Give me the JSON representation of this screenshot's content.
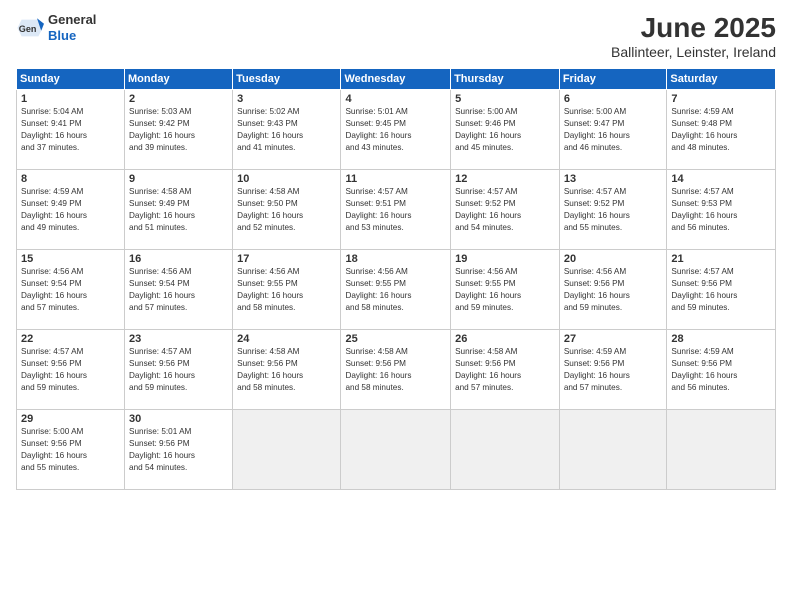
{
  "header": {
    "logo_general": "General",
    "logo_blue": "Blue",
    "month": "June 2025",
    "location": "Ballinteer, Leinster, Ireland"
  },
  "days_of_week": [
    "Sunday",
    "Monday",
    "Tuesday",
    "Wednesday",
    "Thursday",
    "Friday",
    "Saturday"
  ],
  "weeks": [
    [
      {
        "day": 1,
        "info": "Sunrise: 5:04 AM\nSunset: 9:41 PM\nDaylight: 16 hours\nand 37 minutes."
      },
      {
        "day": 2,
        "info": "Sunrise: 5:03 AM\nSunset: 9:42 PM\nDaylight: 16 hours\nand 39 minutes."
      },
      {
        "day": 3,
        "info": "Sunrise: 5:02 AM\nSunset: 9:43 PM\nDaylight: 16 hours\nand 41 minutes."
      },
      {
        "day": 4,
        "info": "Sunrise: 5:01 AM\nSunset: 9:45 PM\nDaylight: 16 hours\nand 43 minutes."
      },
      {
        "day": 5,
        "info": "Sunrise: 5:00 AM\nSunset: 9:46 PM\nDaylight: 16 hours\nand 45 minutes."
      },
      {
        "day": 6,
        "info": "Sunrise: 5:00 AM\nSunset: 9:47 PM\nDaylight: 16 hours\nand 46 minutes."
      },
      {
        "day": 7,
        "info": "Sunrise: 4:59 AM\nSunset: 9:48 PM\nDaylight: 16 hours\nand 48 minutes."
      }
    ],
    [
      {
        "day": 8,
        "info": "Sunrise: 4:59 AM\nSunset: 9:49 PM\nDaylight: 16 hours\nand 49 minutes."
      },
      {
        "day": 9,
        "info": "Sunrise: 4:58 AM\nSunset: 9:49 PM\nDaylight: 16 hours\nand 51 minutes."
      },
      {
        "day": 10,
        "info": "Sunrise: 4:58 AM\nSunset: 9:50 PM\nDaylight: 16 hours\nand 52 minutes."
      },
      {
        "day": 11,
        "info": "Sunrise: 4:57 AM\nSunset: 9:51 PM\nDaylight: 16 hours\nand 53 minutes."
      },
      {
        "day": 12,
        "info": "Sunrise: 4:57 AM\nSunset: 9:52 PM\nDaylight: 16 hours\nand 54 minutes."
      },
      {
        "day": 13,
        "info": "Sunrise: 4:57 AM\nSunset: 9:52 PM\nDaylight: 16 hours\nand 55 minutes."
      },
      {
        "day": 14,
        "info": "Sunrise: 4:57 AM\nSunset: 9:53 PM\nDaylight: 16 hours\nand 56 minutes."
      }
    ],
    [
      {
        "day": 15,
        "info": "Sunrise: 4:56 AM\nSunset: 9:54 PM\nDaylight: 16 hours\nand 57 minutes."
      },
      {
        "day": 16,
        "info": "Sunrise: 4:56 AM\nSunset: 9:54 PM\nDaylight: 16 hours\nand 57 minutes."
      },
      {
        "day": 17,
        "info": "Sunrise: 4:56 AM\nSunset: 9:55 PM\nDaylight: 16 hours\nand 58 minutes."
      },
      {
        "day": 18,
        "info": "Sunrise: 4:56 AM\nSunset: 9:55 PM\nDaylight: 16 hours\nand 58 minutes."
      },
      {
        "day": 19,
        "info": "Sunrise: 4:56 AM\nSunset: 9:55 PM\nDaylight: 16 hours\nand 59 minutes."
      },
      {
        "day": 20,
        "info": "Sunrise: 4:56 AM\nSunset: 9:56 PM\nDaylight: 16 hours\nand 59 minutes."
      },
      {
        "day": 21,
        "info": "Sunrise: 4:57 AM\nSunset: 9:56 PM\nDaylight: 16 hours\nand 59 minutes."
      }
    ],
    [
      {
        "day": 22,
        "info": "Sunrise: 4:57 AM\nSunset: 9:56 PM\nDaylight: 16 hours\nand 59 minutes."
      },
      {
        "day": 23,
        "info": "Sunrise: 4:57 AM\nSunset: 9:56 PM\nDaylight: 16 hours\nand 59 minutes."
      },
      {
        "day": 24,
        "info": "Sunrise: 4:58 AM\nSunset: 9:56 PM\nDaylight: 16 hours\nand 58 minutes."
      },
      {
        "day": 25,
        "info": "Sunrise: 4:58 AM\nSunset: 9:56 PM\nDaylight: 16 hours\nand 58 minutes."
      },
      {
        "day": 26,
        "info": "Sunrise: 4:58 AM\nSunset: 9:56 PM\nDaylight: 16 hours\nand 57 minutes."
      },
      {
        "day": 27,
        "info": "Sunrise: 4:59 AM\nSunset: 9:56 PM\nDaylight: 16 hours\nand 57 minutes."
      },
      {
        "day": 28,
        "info": "Sunrise: 4:59 AM\nSunset: 9:56 PM\nDaylight: 16 hours\nand 56 minutes."
      }
    ],
    [
      {
        "day": 29,
        "info": "Sunrise: 5:00 AM\nSunset: 9:56 PM\nDaylight: 16 hours\nand 55 minutes."
      },
      {
        "day": 30,
        "info": "Sunrise: 5:01 AM\nSunset: 9:56 PM\nDaylight: 16 hours\nand 54 minutes."
      },
      {
        "day": null,
        "info": ""
      },
      {
        "day": null,
        "info": ""
      },
      {
        "day": null,
        "info": ""
      },
      {
        "day": null,
        "info": ""
      },
      {
        "day": null,
        "info": ""
      }
    ]
  ]
}
